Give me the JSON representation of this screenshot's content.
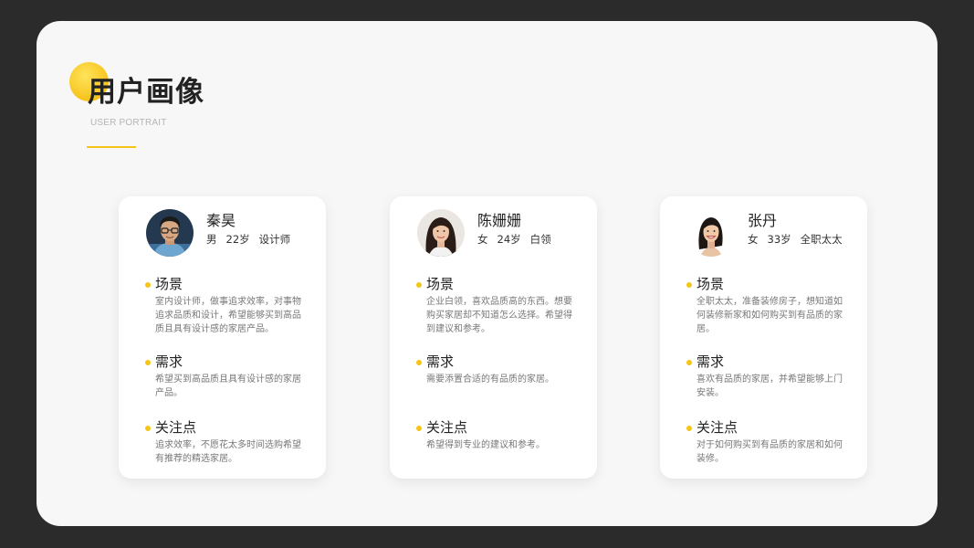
{
  "title": "用户画像",
  "subtitle": "USER PORTRAIT",
  "accent_color": "#f5c518",
  "personas": [
    {
      "name": "秦昊",
      "gender": "男",
      "age": "22岁",
      "occupation": "设计师",
      "avatar": "male-portrait-glasses",
      "sections": [
        {
          "heading": "场景",
          "text": "室内设计师，做事追求效率，对事物追求品质和设计，希望能够买到高品质且具有设计感的家居产品。"
        },
        {
          "heading": "需求",
          "text": "希望买到高品质且具有设计感的家居产品。"
        },
        {
          "heading": "关注点",
          "text": "追求效率，不愿花太多时间选购希望有推荐的精选家居。"
        }
      ]
    },
    {
      "name": "陈姗姗",
      "gender": "女",
      "age": "24岁",
      "occupation": "白领",
      "avatar": "female-portrait-long-hair",
      "sections": [
        {
          "heading": "场景",
          "text": "企业白领，喜欢品质高的东西。想要购买家居却不知道怎么选择。希望得到建议和参考。"
        },
        {
          "heading": "需求",
          "text": "需要添置合适的有品质的家居。"
        },
        {
          "heading": "关注点",
          "text": "希望得到专业的建议和参考。"
        }
      ]
    },
    {
      "name": "张丹",
      "gender": "女",
      "age": "33岁",
      "occupation": "全职太太",
      "avatar": "female-portrait-smiling",
      "sections": [
        {
          "heading": "场景",
          "text": "全职太太，准备装修房子，想知道如何装修新家和如何购买到有品质的家居。"
        },
        {
          "heading": "需求",
          "text": "喜欢有品质的家居，并希望能够上门安装。"
        },
        {
          "heading": "关注点",
          "text": "对于如何购买到有品质的家居和如何装修。"
        }
      ]
    }
  ]
}
